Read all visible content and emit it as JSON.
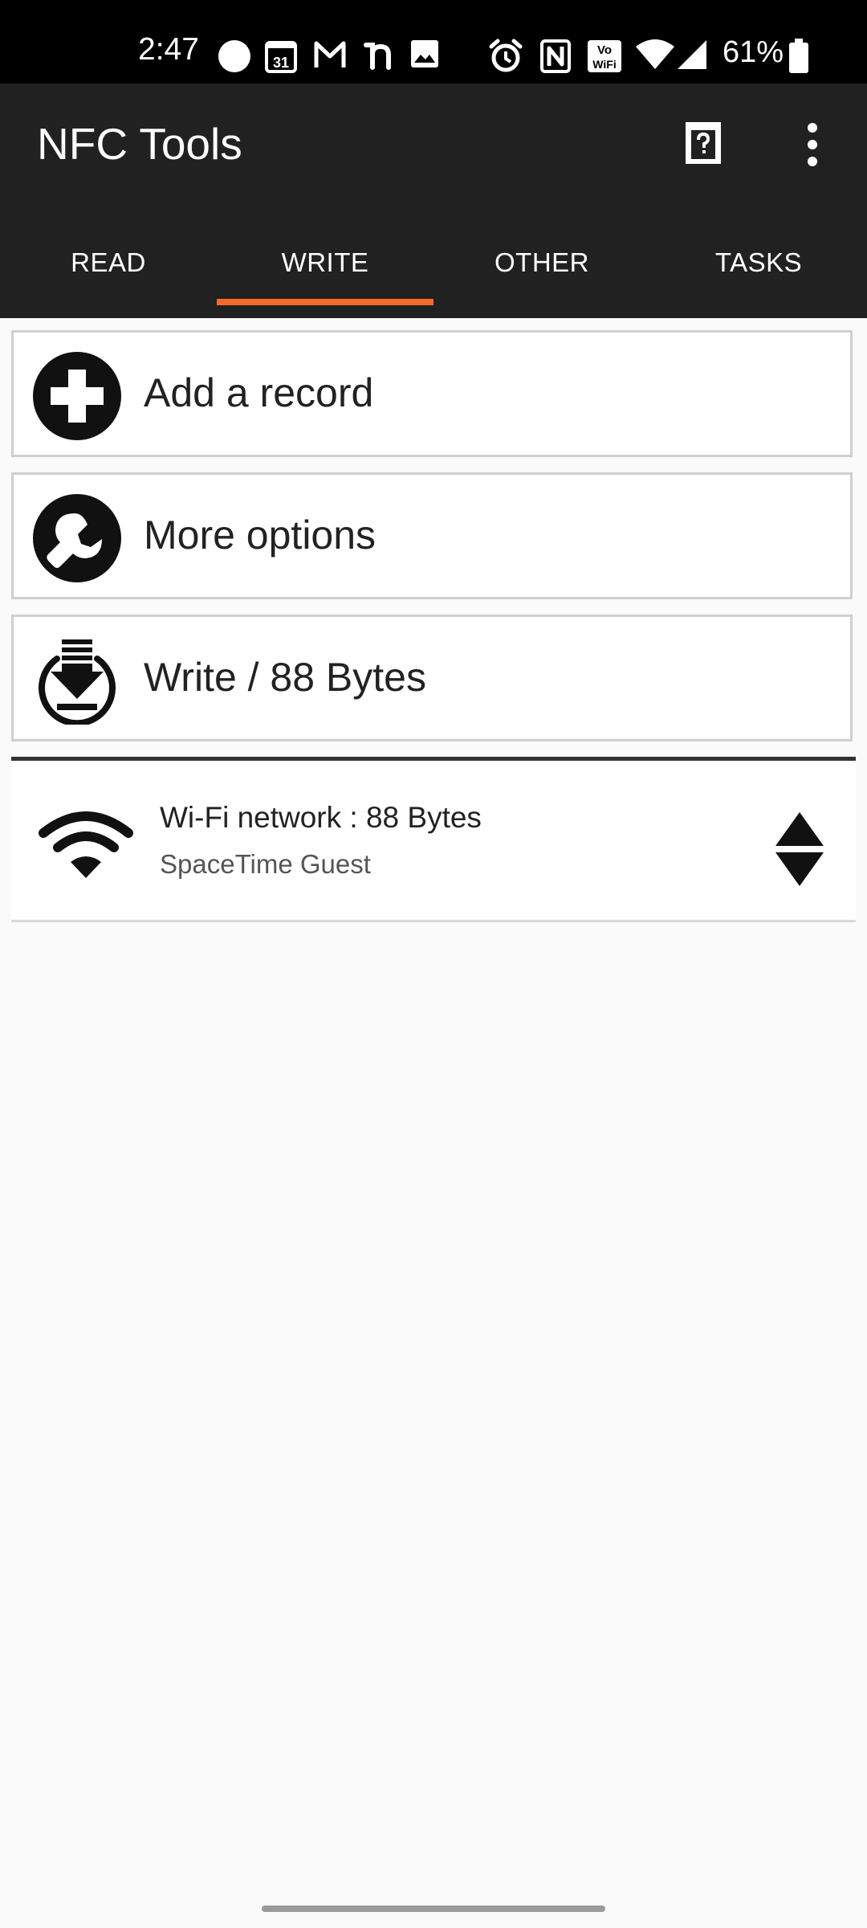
{
  "status_bar": {
    "time": "2:47",
    "battery": "61%",
    "calendar_day": "31",
    "icons": [
      "circle-icon",
      "calendar-icon",
      "gmail-icon",
      "app-icon",
      "image-icon",
      "alarm-icon",
      "nfc-icon",
      "vowifi-icon",
      "wifi-icon",
      "signal-icon",
      "battery-icon"
    ]
  },
  "app_bar": {
    "title": "NFC Tools",
    "help_icon": "help-icon",
    "menu_icon": "more-vert-icon"
  },
  "tabs": [
    {
      "label": "READ",
      "selected": false
    },
    {
      "label": "WRITE",
      "selected": true
    },
    {
      "label": "OTHER",
      "selected": false
    },
    {
      "label": "TASKS",
      "selected": false
    }
  ],
  "colors": {
    "accent": "#f26b2a",
    "toolbar": "#212121",
    "background": "#fafafa"
  },
  "actions": [
    {
      "label": "Add a record",
      "icon": "add-circle-icon"
    },
    {
      "label": "More options",
      "icon": "wrench-icon"
    },
    {
      "label": "Write / 88 Bytes",
      "icon": "write-download-icon"
    }
  ],
  "records": [
    {
      "title": "Wi-Fi network : 88 Bytes",
      "subtitle": "SpaceTime Guest",
      "icon": "wifi-icon",
      "handle_icon": "reorder-icon"
    }
  ]
}
